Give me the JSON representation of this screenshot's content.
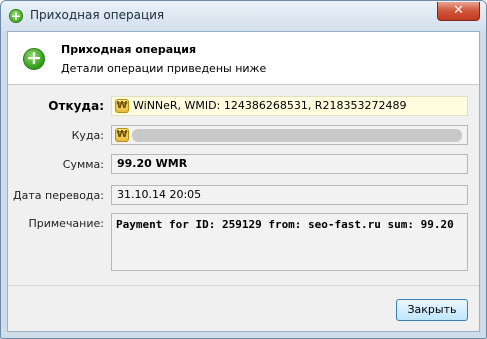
{
  "window": {
    "title": "Приходная операция",
    "close_symbol": "✕"
  },
  "header": {
    "title": "Приходная операция",
    "subtitle": "Детали операции приведены ниже",
    "icon": "plus-circle-icon"
  },
  "fields": {
    "from": {
      "label": "Откуда:",
      "value": "WiNNeR, WMID: 124386268531, R218353272489",
      "icon": "wm-passport-icon"
    },
    "to": {
      "label": "Куда:",
      "value": "",
      "icon": "wm-passport-icon"
    },
    "amount": {
      "label": "Сумма:",
      "value": "99.20 WMR"
    },
    "date": {
      "label": "Дата перевода:",
      "value": "31.10.14 20:05"
    },
    "note": {
      "label": "Примечание:",
      "value": "Payment for ID:  259129  from: seo-fast.ru sum: 99.20"
    }
  },
  "buttons": {
    "close_label": "Закрыть"
  },
  "colors": {
    "accent_green": "#2e9a18",
    "highlight_field": "#fffde0",
    "button_border": "#3c7fb1"
  }
}
